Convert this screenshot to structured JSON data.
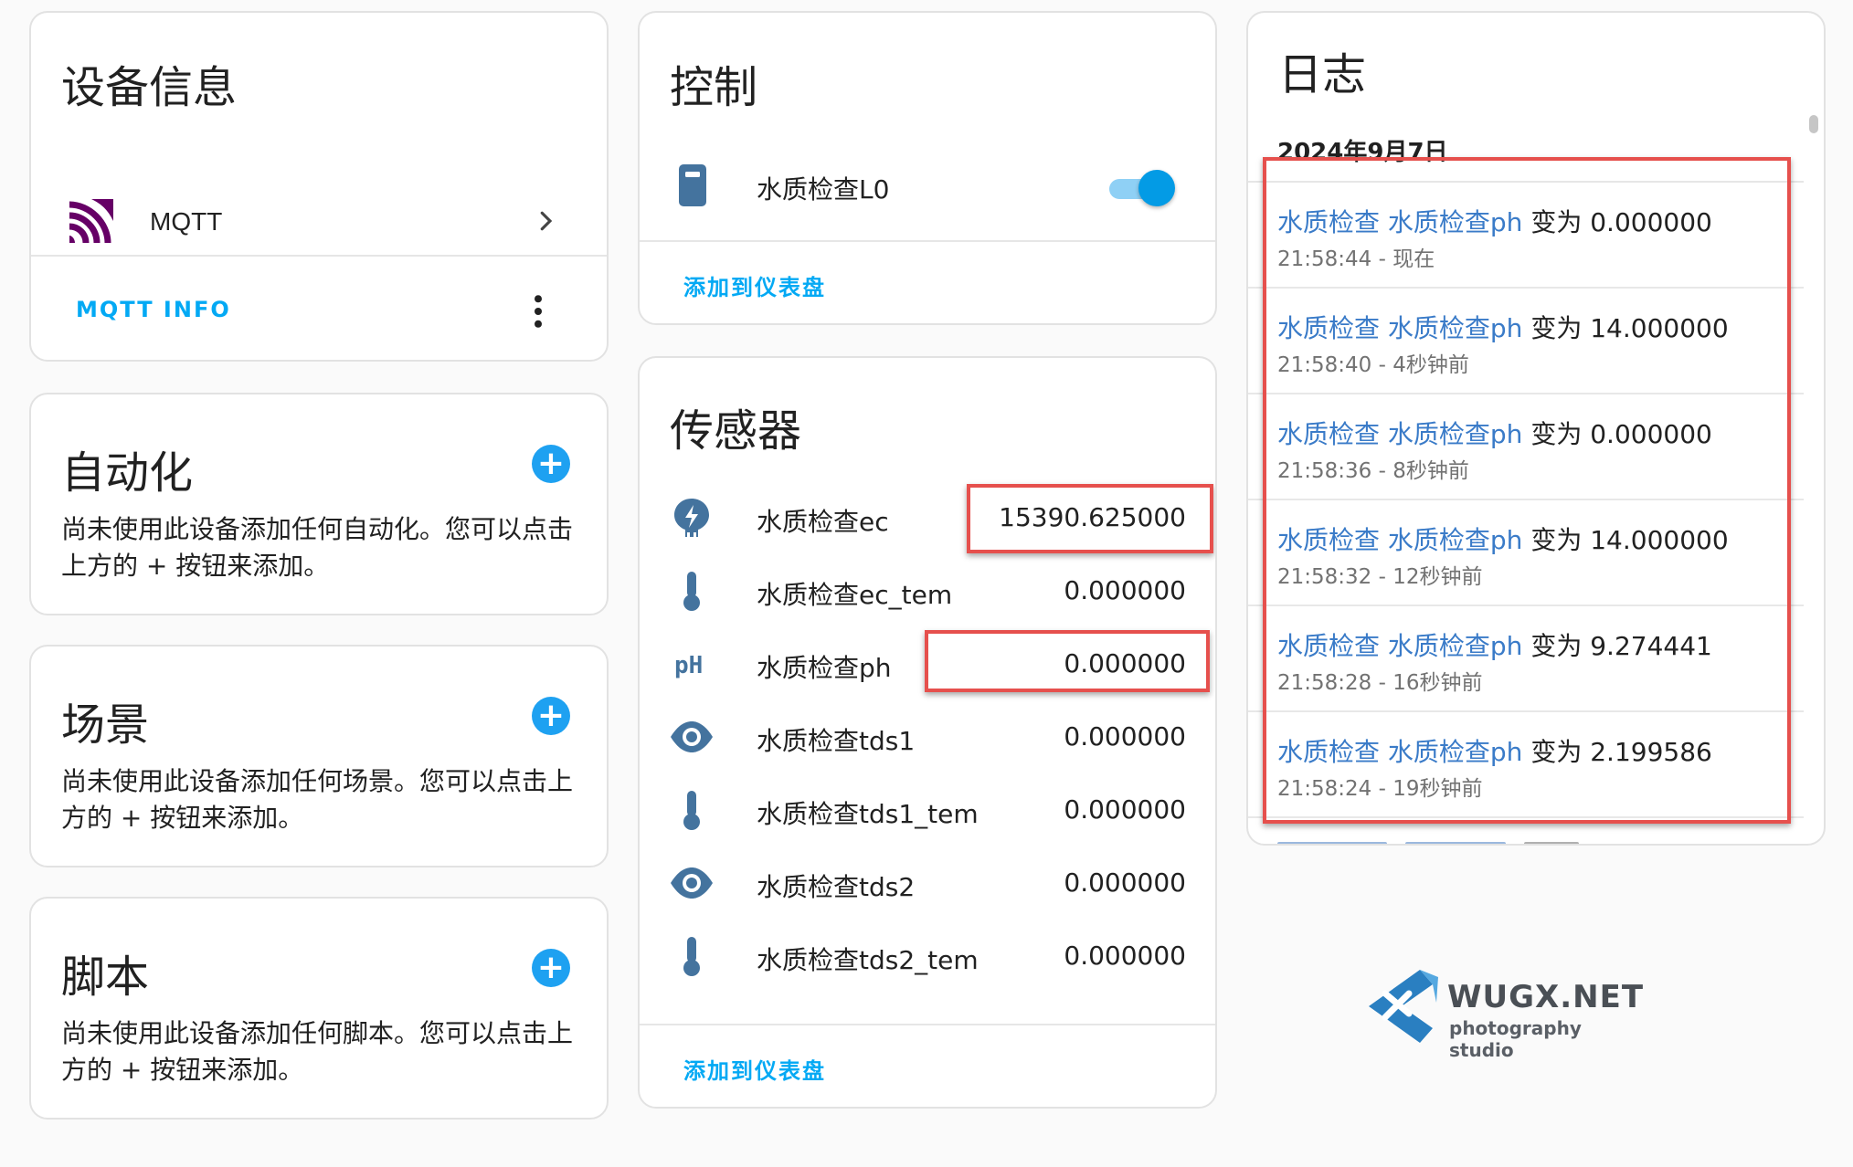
{
  "device_info": {
    "title": "设备信息",
    "integration": {
      "name": "MQTT",
      "icon": "mqtt-logo-icon"
    },
    "action_label": "MQTT INFO"
  },
  "automation": {
    "title": "自动化",
    "description": "尚未使用此设备添加任何自动化。您可以点击上方的 + 按钮来添加。"
  },
  "scene": {
    "title": "场景",
    "description": "尚未使用此设备添加任何场景。您可以点击上方的 + 按钮来添加。"
  },
  "script": {
    "title": "脚本",
    "description": "尚未使用此设备添加任何脚本。您可以点击上方的 + 按钮来添加。"
  },
  "controls": {
    "title": "控制",
    "items": [
      {
        "name": "水质检查L0",
        "icon": "battery-icon",
        "state": "on"
      }
    ],
    "add_to_dashboard": "添加到仪表盘"
  },
  "sensors": {
    "title": "传感器",
    "items": [
      {
        "name": "水质检查ec",
        "value": "15390.625000",
        "icon": "water-flash-icon"
      },
      {
        "name": "水质检查ec_tem",
        "value": "0.000000",
        "icon": "thermometer-icon"
      },
      {
        "name": "水质检查ph",
        "value": "0.000000",
        "icon": "ph-icon"
      },
      {
        "name": "水质检查tds1",
        "value": "0.000000",
        "icon": "eye-icon"
      },
      {
        "name": "水质检查tds1_tem",
        "value": "0.000000",
        "icon": "thermometer-icon"
      },
      {
        "name": "水质检查tds2",
        "value": "0.000000",
        "icon": "eye-icon"
      },
      {
        "name": "水质检查tds2_tem",
        "value": "0.000000",
        "icon": "thermometer-icon"
      }
    ],
    "add_to_dashboard": "添加到仪表盘"
  },
  "logbook": {
    "title": "日志",
    "date": "2024年9月7日",
    "entries": [
      {
        "entity": "水质检查 水质检查ph",
        "message": "变为 0.000000",
        "time": "21:58:44 - 现在"
      },
      {
        "entity": "水质检查 水质检查ph",
        "message": "变为 14.000000",
        "time": "21:58:40 - 4秒钟前"
      },
      {
        "entity": "水质检查 水质检查ph",
        "message": "变为 0.000000",
        "time": "21:58:36 - 8秒钟前"
      },
      {
        "entity": "水质检查 水质检查ph",
        "message": "变为 14.000000",
        "time": "21:58:32 - 12秒钟前"
      },
      {
        "entity": "水质检查 水质检查ph",
        "message": "变为 9.274441",
        "time": "21:58:28 - 16秒钟前"
      },
      {
        "entity": "水质检查 水质检查ph",
        "message": "变为 2.199586",
        "time": "21:58:24 - 19秒钟前"
      }
    ]
  },
  "watermark": {
    "brand": "WUGX.NET",
    "tagline": "photography studio"
  },
  "colors": {
    "accent": "#03a9f4",
    "icon": "#44739e",
    "highlight_box": "#e6504d",
    "logbook_entity": "#3a7bc8",
    "mqtt_logo": "#660066"
  }
}
